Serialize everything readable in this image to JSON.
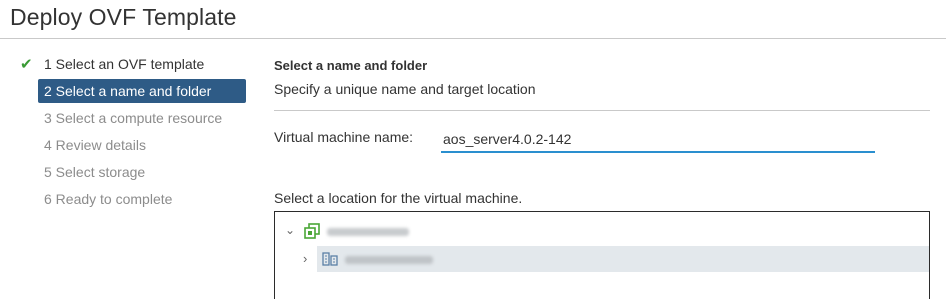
{
  "page": {
    "title": "Deploy OVF Template"
  },
  "steps": [
    {
      "label": "1 Select an OVF template",
      "state": "done"
    },
    {
      "label": "2 Select a name and folder",
      "state": "current"
    },
    {
      "label": "3 Select a compute resource",
      "state": "pending"
    },
    {
      "label": "4 Review details",
      "state": "pending"
    },
    {
      "label": "5 Select storage",
      "state": "pending"
    },
    {
      "label": "6 Ready to complete",
      "state": "pending"
    }
  ],
  "main": {
    "section_title": "Select a name and folder",
    "section_subtitle": "Specify a unique name and target location",
    "vm_name_label": "Virtual machine name:",
    "vm_name_value": "aos_server4.0.2-142",
    "location_label": "Select a location for the virtual machine."
  },
  "icons": {
    "check": "checkmark-icon",
    "chevron_down": "chevron-down-icon",
    "chevron_right": "chevron-right-icon",
    "vcenter": "vcenter-icon",
    "datacenter": "datacenter-icon"
  },
  "colors": {
    "current_step_bg": "#2e5b86",
    "check_green": "#3a9b35",
    "input_underline": "#2a8fcf",
    "pending_text": "#8c8c8c",
    "selected_row_bg": "#e3e8ec"
  }
}
